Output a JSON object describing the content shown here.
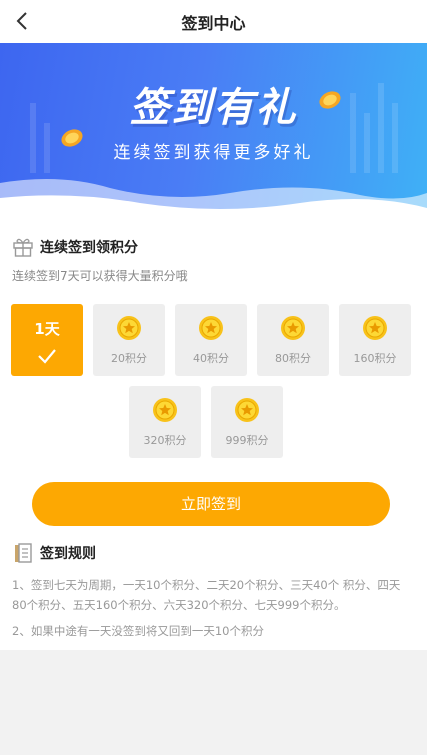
{
  "header": {
    "title": "签到中心",
    "back_icon": "chevron-left-icon"
  },
  "banner": {
    "title": "签到有礼",
    "subtitle": "连续签到获得更多好礼"
  },
  "section": {
    "title": "连续签到领积分",
    "desc": "连续签到7天可以获得大量积分哦",
    "icon": "gift-icon"
  },
  "days": [
    {
      "label": "1天",
      "state": "signed"
    },
    {
      "points": "20积分"
    },
    {
      "points": "40积分"
    },
    {
      "points": "80积分"
    },
    {
      "points": "160积分"
    },
    {
      "points": "320积分"
    },
    {
      "points": "999积分"
    }
  ],
  "sign_button": "立即签到",
  "rules": {
    "title": "签到规则",
    "icon": "document-icon",
    "items": [
      "1、签到七天为周期，一天10个积分、二天20个积分、三天40个 积分、四天80个积分、五天160个积分、六天320个积分、七天999个积分。",
      "2、如果中途有一天没签到将又回到一天10个积分"
    ]
  },
  "colors": {
    "accent": "#fda802",
    "banner_start": "#3d66f0",
    "banner_end": "#3fb1f6",
    "coin": "#f8c21a"
  }
}
